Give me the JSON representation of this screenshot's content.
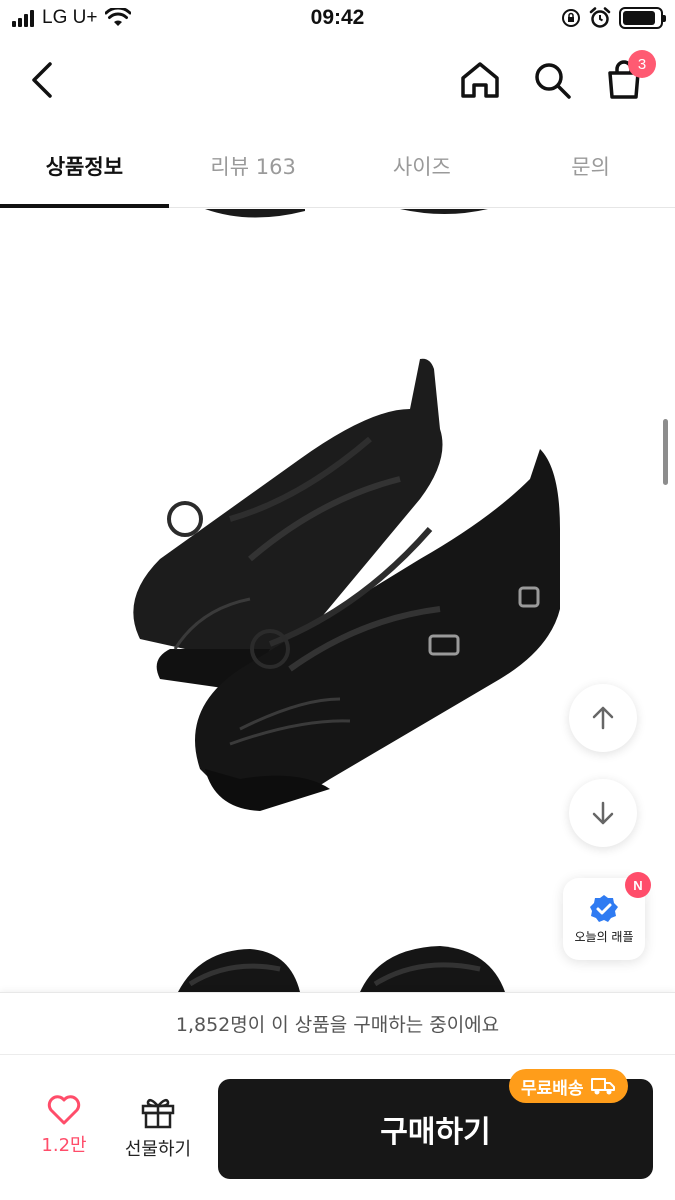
{
  "status_bar": {
    "carrier": "LG U+",
    "time": "09:42",
    "battery_level": 0.9
  },
  "nav": {
    "back_icon": "chevron-left-icon",
    "home_icon": "home-icon",
    "search_icon": "search-icon",
    "cart_icon": "shopping-bag-icon",
    "cart_count": "3"
  },
  "tabs": [
    {
      "label": "상품정보",
      "active": true
    },
    {
      "label": "리뷰 163",
      "active": false
    },
    {
      "label": "사이즈",
      "active": false
    },
    {
      "label": "문의",
      "active": false
    }
  ],
  "floating": {
    "scroll_up_icon": "arrow-up-icon",
    "scroll_down_icon": "arrow-down-icon",
    "raffle_label": "오늘의 래플",
    "raffle_badge": "N"
  },
  "buyers_banner": "1,852명이 이 상품을 구매하는 중이에요",
  "bottom_bar": {
    "like_count": "1.2만",
    "gift_label": "선물하기",
    "buy_label": "구매하기",
    "free_shipping_label": "무료배송"
  },
  "colors": {
    "accent_pink": "#ff5a72",
    "buy_button": "#171717",
    "free_shipping": "#ff9d1a",
    "verified_blue": "#2f7bf2"
  }
}
